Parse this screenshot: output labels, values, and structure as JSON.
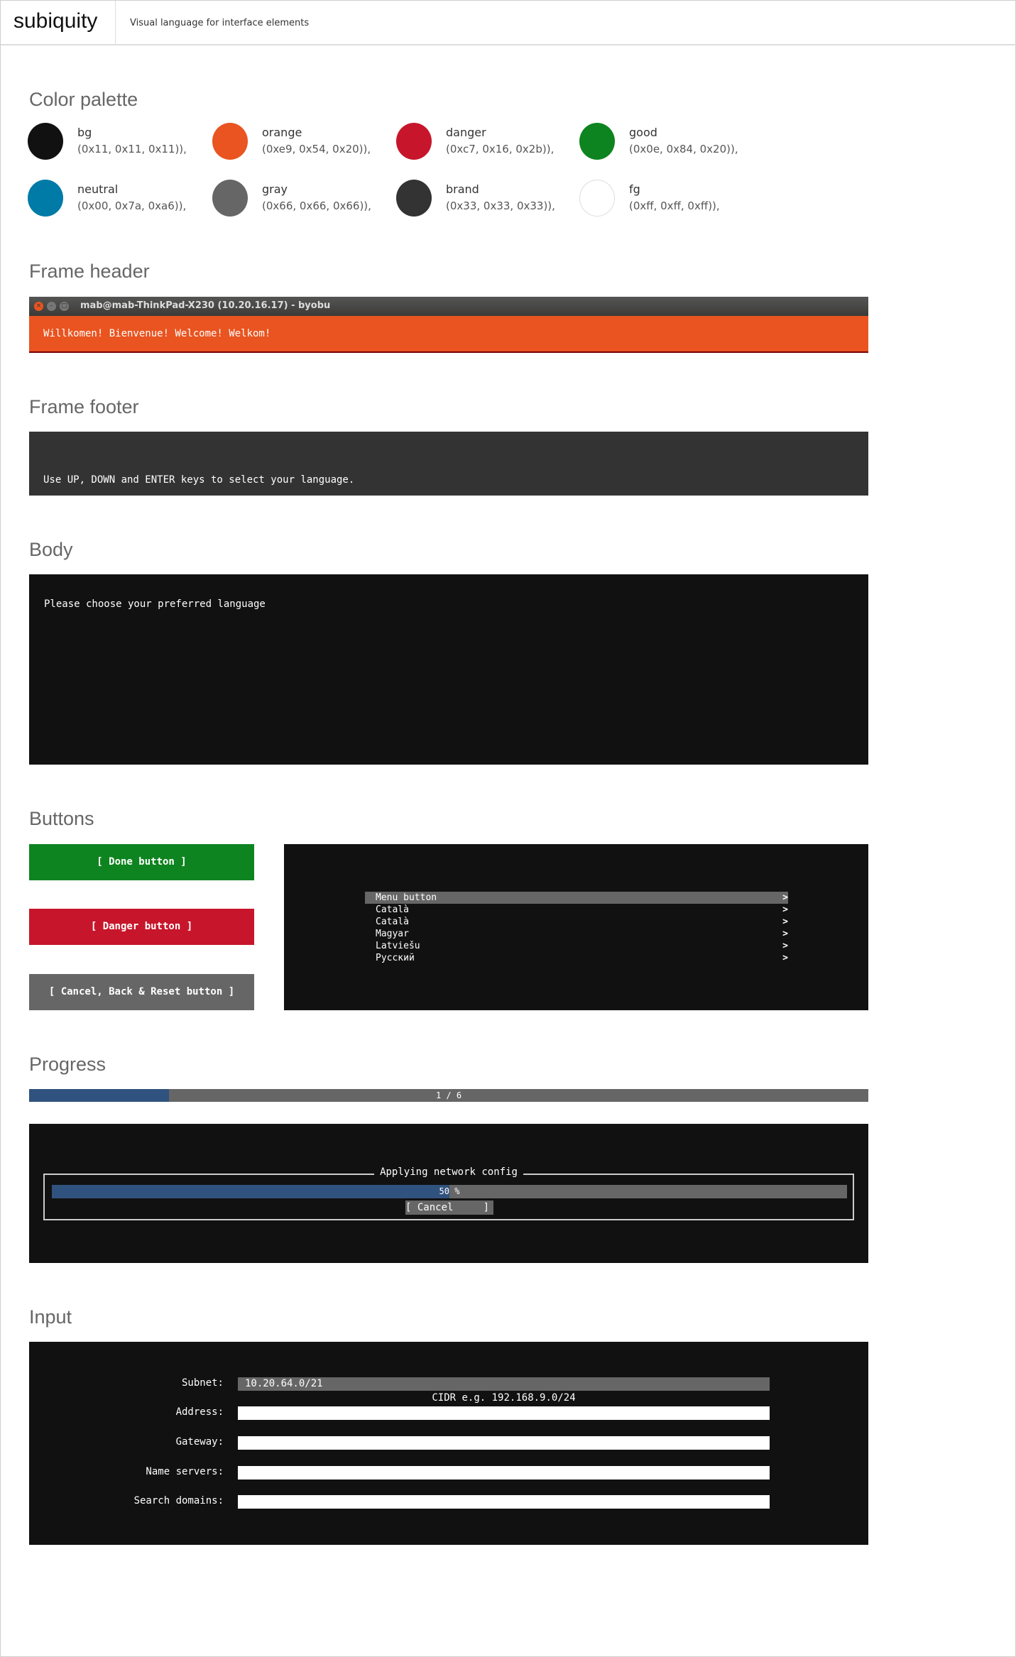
{
  "header": {
    "logo": "subiquity",
    "tagline": "Visual language for interface elements"
  },
  "sections": {
    "palette": "Color palette",
    "frame_header": "Frame header",
    "frame_footer": "Frame footer",
    "body": "Body",
    "buttons": "Buttons",
    "progress": "Progress",
    "input": "Input"
  },
  "palette": [
    {
      "name": "bg",
      "value": "(0x11, 0x11, 0x11)),",
      "color": "#111111"
    },
    {
      "name": "orange",
      "value": "(0xe9, 0x54, 0x20)),",
      "color": "#e95420"
    },
    {
      "name": "danger",
      "value": "(0xc7, 0x16, 0x2b)),",
      "color": "#c7162b"
    },
    {
      "name": "good",
      "value": "(0x0e, 0x84, 0x20)),",
      "color": "#0e8420"
    },
    {
      "name": "neutral",
      "value": "(0x00, 0x7a, 0xa6)),",
      "color": "#007aa6"
    },
    {
      "name": "gray",
      "value": "(0x66, 0x66, 0x66)),",
      "color": "#666666"
    },
    {
      "name": "brand",
      "value": "(0x33, 0x33, 0x33)),",
      "color": "#333333"
    },
    {
      "name": "fg",
      "value": "(0xff, 0xff, 0xff)),",
      "color": "#ffffff"
    }
  ],
  "frame_header": {
    "window_title": "mab@mab-ThinkPad-X230 (10.20.16.17) - byobu",
    "text": "Willkomen! Bienvenue! Welcome! Welkom!"
  },
  "frame_footer": {
    "text": "Use UP, DOWN and ENTER keys to select your language."
  },
  "body": {
    "text": "Please choose your preferred language"
  },
  "buttons": {
    "done": "[ Done button ]",
    "danger": "[ Danger button ]",
    "cancel": "[ Cancel, Back & Reset button ]"
  },
  "menu": {
    "items": [
      {
        "label": "Menu button",
        "arrow": ">"
      },
      {
        "label": "Català",
        "arrow": ">"
      },
      {
        "label": "Català",
        "arrow": ">"
      },
      {
        "label": "Magyar",
        "arrow": ">"
      },
      {
        "label": "Latviešu",
        "arrow": ">"
      },
      {
        "label": "Русский",
        "arrow": ">"
      }
    ]
  },
  "progress": {
    "step_label": "1 / 6",
    "step_fraction": 0.1667,
    "dialog_title": "Applying network config",
    "percent_label": "50 %",
    "percent": 50,
    "cancel": "[ Cancel     ]"
  },
  "input": {
    "subnet_label": "Subnet:",
    "subnet_value": "10.20.64.0/21",
    "subnet_help": "CIDR e.g. 192.168.9.0/24",
    "address_label": "Address:",
    "gateway_label": "Gateway:",
    "nameservers_label": "Name servers:",
    "searchdomains_label": "Search domains:"
  }
}
